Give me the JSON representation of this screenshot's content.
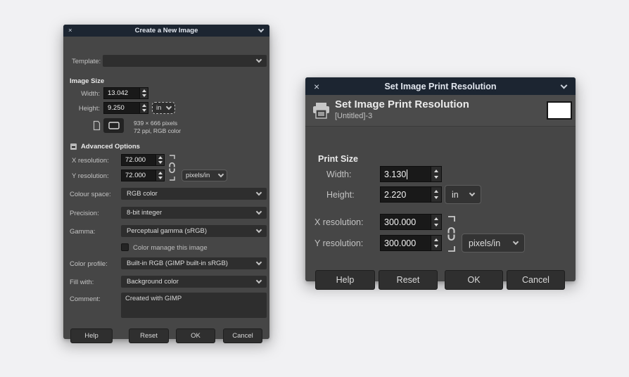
{
  "icons": {
    "close": "×"
  },
  "new_image_dialog": {
    "title": "Create a New Image",
    "template_label": "Template:",
    "image_size_label": "Image Size",
    "width_label": "Width:",
    "width_value": "13.042",
    "height_label": "Height:",
    "height_value": "9.250",
    "size_unit": "in",
    "size_info_pixels": "939 × 666 pixels",
    "size_info_detail": "72 ppi, RGB color",
    "advanced_options_label": "Advanced Options",
    "x_resolution_label": "X resolution:",
    "x_resolution_value": "72.000",
    "y_resolution_label": "Y resolution:",
    "y_resolution_value": "72.000",
    "resolution_unit": "pixels/in",
    "colour_space_label": "Colour space:",
    "colour_space_value": "RGB color",
    "precision_label": "Precision:",
    "precision_value": "8-bit integer",
    "gamma_label": "Gamma:",
    "gamma_value": "Perceptual gamma (sRGB)",
    "color_manage_label": "Color manage this image",
    "color_profile_label": "Color profile:",
    "color_profile_value": "Built-in RGB (GIMP built-in sRGB)",
    "fill_with_label": "Fill with:",
    "fill_with_value": "Background color",
    "comment_label": "Comment:",
    "comment_value": "Created with GIMP",
    "buttons": {
      "help": "Help",
      "reset": "Reset",
      "ok": "OK",
      "cancel": "Cancel"
    }
  },
  "print_resolution_dialog": {
    "title": "Set Image Print Resolution",
    "header_title": "Set Image Print Resolution",
    "header_subtitle": "[Untitled]-3",
    "print_size_label": "Print Size",
    "width_label": "Width:",
    "width_value": "3.130",
    "height_label": "Height:",
    "height_value": "2.220",
    "size_unit": "in",
    "x_resolution_label": "X resolution:",
    "x_resolution_value": "300.000",
    "y_resolution_label": "Y resolution:",
    "y_resolution_value": "300.000",
    "resolution_unit": "pixels/in",
    "buttons": {
      "help": "Help",
      "reset": "Reset",
      "ok": "OK",
      "cancel": "Cancel"
    }
  }
}
